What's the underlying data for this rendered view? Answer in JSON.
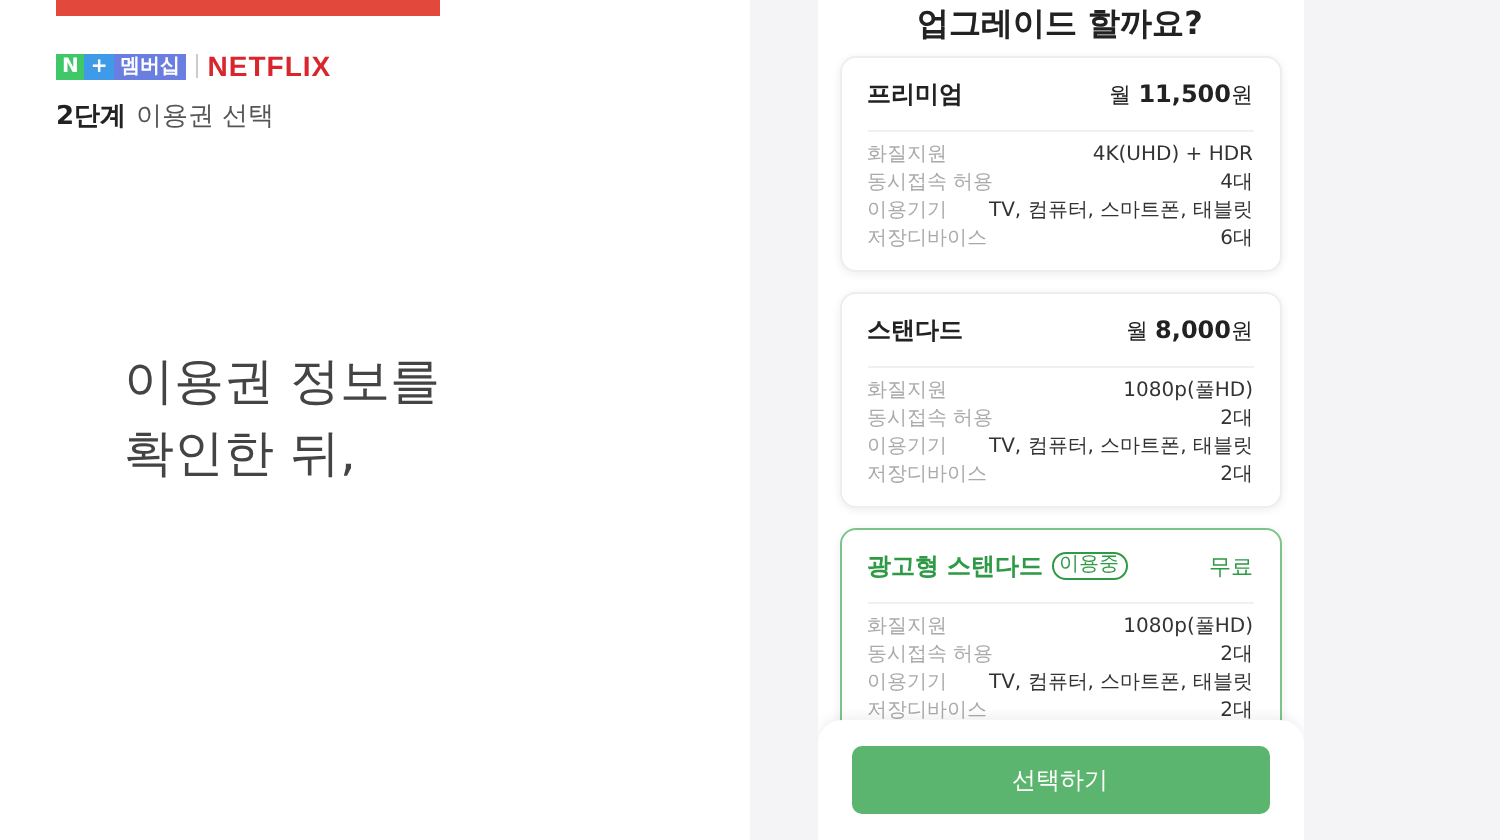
{
  "left": {
    "logo": {
      "badge_n": "N",
      "badge_plus": "+",
      "badge_label": "멤버십",
      "brand": "NETFLIX"
    },
    "step": {
      "number": "2단계",
      "label": "이용권 선택"
    },
    "headline": [
      "이용권 정보를",
      "확인한 뒤,"
    ]
  },
  "right": {
    "heading": "업그레이드 할까요?",
    "plans": [
      {
        "name": "프리미엄",
        "price": "월 **11,500**원",
        "selected": false,
        "specs": [
          {
            "label": "화질지원",
            "value": "4K(UHD) + HDR"
          },
          {
            "label": "동시접속 허용",
            "value": "4대"
          },
          {
            "label": "이용기기",
            "value": "TV, 컴퓨터, 스마트폰, 태블릿"
          },
          {
            "label": "저장디바이스",
            "value": "6대"
          }
        ]
      },
      {
        "name": "스탠다드",
        "price": "월 **8,000**원",
        "selected": false,
        "specs": [
          {
            "label": "화질지원",
            "value": "1080p(풀HD)"
          },
          {
            "label": "동시접속 허용",
            "value": "2대"
          },
          {
            "label": "이용기기",
            "value": "TV, 컴퓨터, 스마트폰, 태블릿"
          },
          {
            "label": "저장디바이스",
            "value": "2대"
          }
        ]
      },
      {
        "name": "광고형 스탠다드",
        "badge": "이용중",
        "price": "무료",
        "selected": true,
        "specs": [
          {
            "label": "화질지원",
            "value": "1080p(풀HD)"
          },
          {
            "label": "동시접속 허용",
            "value": "2대"
          },
          {
            "label": "이용기기",
            "value": "TV, 컴퓨터, 스마트폰, 태블릿"
          },
          {
            "label": "저장디바이스",
            "value": "2대"
          }
        ]
      }
    ],
    "button": "선택하기"
  }
}
